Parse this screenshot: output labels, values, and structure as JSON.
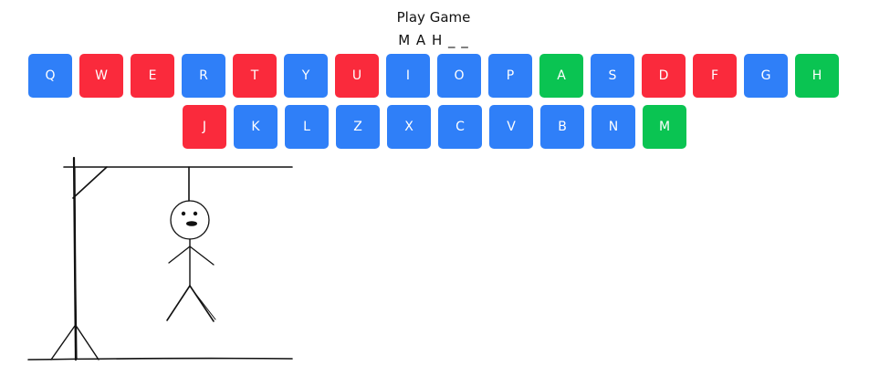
{
  "header": {
    "title": "Play Game",
    "word_display": "M A H _ _"
  },
  "colors": {
    "unused": "#2f7ff8",
    "wrong": "#fa2a3c",
    "correct": "#0ac452"
  },
  "keyboard": {
    "rows": [
      [
        {
          "letter": "Q",
          "state": "unused"
        },
        {
          "letter": "W",
          "state": "wrong"
        },
        {
          "letter": "E",
          "state": "wrong"
        },
        {
          "letter": "R",
          "state": "unused"
        },
        {
          "letter": "T",
          "state": "wrong"
        },
        {
          "letter": "Y",
          "state": "unused"
        },
        {
          "letter": "U",
          "state": "wrong"
        },
        {
          "letter": "I",
          "state": "unused"
        },
        {
          "letter": "O",
          "state": "unused"
        },
        {
          "letter": "P",
          "state": "unused"
        },
        {
          "letter": "A",
          "state": "correct"
        },
        {
          "letter": "S",
          "state": "unused"
        },
        {
          "letter": "D",
          "state": "wrong"
        },
        {
          "letter": "F",
          "state": "wrong"
        },
        {
          "letter": "G",
          "state": "unused"
        },
        {
          "letter": "H",
          "state": "correct"
        }
      ],
      [
        {
          "letter": "J",
          "state": "wrong"
        },
        {
          "letter": "K",
          "state": "unused"
        },
        {
          "letter": "L",
          "state": "unused"
        },
        {
          "letter": "Z",
          "state": "unused"
        },
        {
          "letter": "X",
          "state": "unused"
        },
        {
          "letter": "C",
          "state": "unused"
        },
        {
          "letter": "V",
          "state": "unused"
        },
        {
          "letter": "B",
          "state": "unused"
        },
        {
          "letter": "N",
          "state": "unused"
        },
        {
          "letter": "M",
          "state": "correct"
        }
      ]
    ]
  },
  "hangman": {
    "icon": "hangman-drawing",
    "wrong_guesses": 7
  }
}
